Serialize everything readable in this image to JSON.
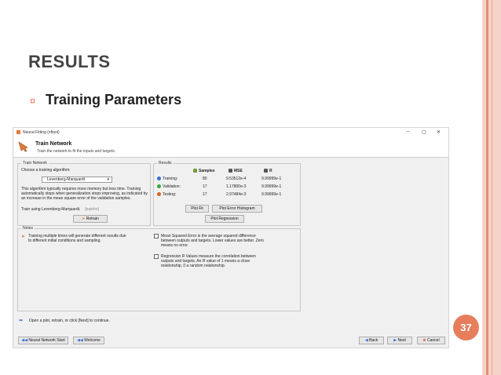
{
  "slide": {
    "title": "RESULTS",
    "bullet_glyph": "¤",
    "subtitle": "Training Parameters",
    "page_number": "37"
  },
  "window": {
    "title": "Neural Fitting (nftool)",
    "controls": {
      "minimize": "–",
      "maximize": "▢",
      "close": "✕"
    },
    "header": {
      "title": "Train Network",
      "subtitle": "Train the network to fit the inputs and targets."
    },
    "train_network": {
      "group_label": "Train Network",
      "choose_label": "Choose a training algorithm:",
      "algorithm": "Levenberg-Marquardt",
      "description": [
        "This algorithm typically requires more memory but less time. Training",
        "automatically stops when generalization stops improving, as indicated by",
        "an increase in the mean square error of the validation samples."
      ],
      "train_using": "Train using Levenberg-Marquardt.",
      "train_using_hint": "(trainlm)",
      "retrain_button": "Retrain"
    },
    "results": {
      "group_label": "Results",
      "columns": [
        "Samples",
        "MSE",
        "R"
      ],
      "rows": [
        {
          "label": "Training:",
          "samples": "80",
          "mse": "9.53512e-4",
          "r": "9.99999e-1",
          "color": "#3a6fd8"
        },
        {
          "label": "Validation:",
          "samples": "17",
          "mse": "1.17800e-3",
          "r": "9.99999e-1",
          "color": "#3aa63a"
        },
        {
          "label": "Testing:",
          "samples": "17",
          "mse": "2.97484e-3",
          "r": "9.99999e-1",
          "color": "#d9622b"
        }
      ],
      "plot_fit_button": "Plot Fit",
      "plot_error_histogram_button": "Plot Error Histogram",
      "plot_regression_button": "Plot Regression"
    },
    "notes": {
      "group_label": "Notes",
      "left_note": [
        "Training multiple times will generate different results due",
        "to different initial conditions and sampling."
      ],
      "mse_note": [
        "Mean Squared Error is the average squared difference",
        "between outputs and targets. Lower values are better. Zero",
        "means no error."
      ],
      "r_note": [
        "Regression R Values measure the correlation between",
        "outputs and targets. An R value of 1 means a close",
        "relationship, 0 a random relationship."
      ]
    },
    "status": "Open a plot, retrain, or click [Next] to continue.",
    "footer": {
      "neural_network_start": "Neural Network Start",
      "welcome": "Welcome",
      "back": "Back",
      "next": "Next",
      "cancel": "Cancel"
    }
  }
}
